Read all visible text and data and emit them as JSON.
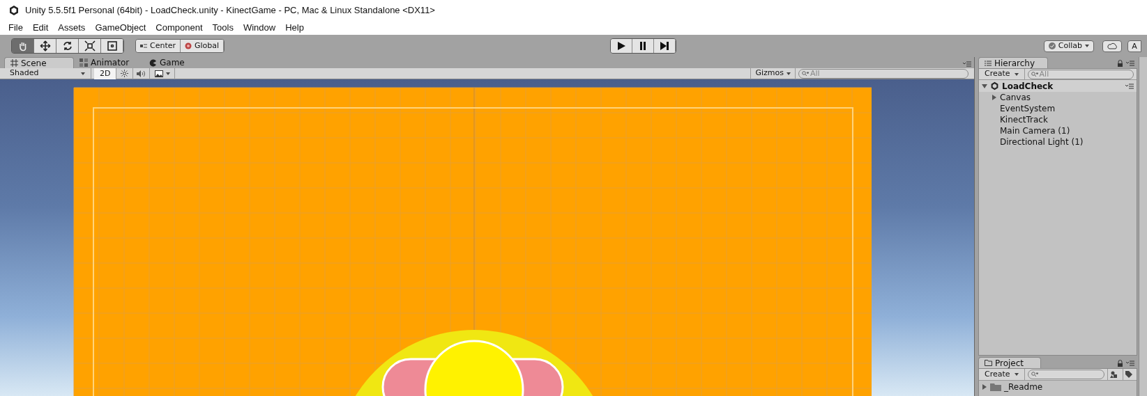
{
  "window": {
    "title": "Unity 5.5.5f1 Personal (64bit) - LoadCheck.unity - KinectGame - PC, Mac & Linux Standalone <DX11>"
  },
  "menu": [
    "File",
    "Edit",
    "Assets",
    "GameObject",
    "Component",
    "Tools",
    "Window",
    "Help"
  ],
  "tools": [
    {
      "kind": "hand",
      "selected": true
    },
    {
      "kind": "move",
      "selected": false
    },
    {
      "kind": "rotate",
      "selected": false
    },
    {
      "kind": "scale",
      "selected": false
    },
    {
      "kind": "rect",
      "selected": false
    }
  ],
  "pivot": [
    "Center",
    "Global"
  ],
  "playback": [
    {
      "kind": "play"
    },
    {
      "kind": "pause"
    },
    {
      "kind": "step"
    }
  ],
  "collab": "Collab",
  "account": "A",
  "scene_tabs": [
    {
      "label": "Scene",
      "kind": "scene",
      "selected": true
    },
    {
      "label": "Animator",
      "kind": "animator",
      "selected": false
    },
    {
      "label": "Game",
      "kind": "game",
      "selected": false
    }
  ],
  "scene_toolbar": {
    "shading": "Shaded",
    "mode_2d": {
      "label": "2D",
      "on": true
    },
    "gizmos": "Gizmos",
    "search": {
      "placeholder": "All"
    }
  },
  "hierarchy": {
    "title": "Hierarchy",
    "create": "Create",
    "search": {
      "placeholder": "All"
    },
    "scene": "LoadCheck",
    "items": [
      {
        "name": "Canvas",
        "expanded": false,
        "has_children": true
      },
      {
        "name": "EventSystem",
        "has_children": false
      },
      {
        "name": "KinectTrack",
        "has_children": false
      },
      {
        "name": "Main Camera (1)",
        "has_children": false
      },
      {
        "name": "Directional Light (1)",
        "has_children": false
      }
    ]
  },
  "project": {
    "title": "Project",
    "create": "Create",
    "items": [
      {
        "name": "_Readme",
        "expanded": false
      }
    ]
  }
}
